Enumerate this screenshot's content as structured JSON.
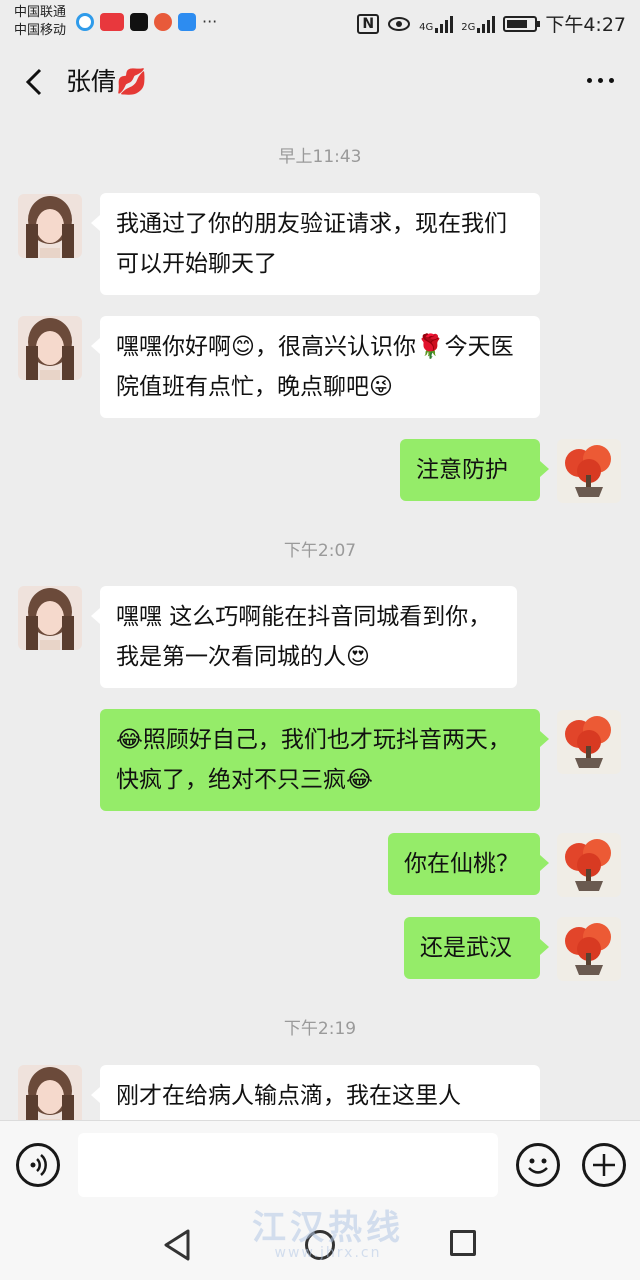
{
  "status_bar": {
    "carrier1": "中国联通",
    "carrier2": "中国移动",
    "apps": [
      "browser-icon",
      "toutiao-icon",
      "douyin-icon",
      "weibo-icon",
      "shield-icon"
    ],
    "app_colors": [
      "#2f9bea",
      "#e8383d",
      "#111111",
      "#e85a3a",
      "#2d8cf0"
    ],
    "more": "···",
    "nfc": "N",
    "net1": "4G",
    "net2": "2G",
    "battery_level": 0.75,
    "time": "下午4:27"
  },
  "header": {
    "back_icon": "chevron-left-icon",
    "title": "张倩💋",
    "more_icon": "more-dots-icon"
  },
  "chat": {
    "timestamps": [
      "早上11:43",
      "下午2:07",
      "下午2:19"
    ],
    "messages": [
      {
        "side": "left",
        "text": "我通过了你的朋友验证请求，现在我们可以开始聊天了"
      },
      {
        "side": "left",
        "text": "嘿嘿你好啊😊，很高兴认识你🌹今天医院值班有点忙，晚点聊吧😜"
      },
      {
        "side": "right",
        "text": "注意防护"
      },
      {
        "side": "left",
        "text": "嘿嘿 这么巧啊能在抖音同城看到你，我是第一次看同城的人😍"
      },
      {
        "side": "right",
        "text": "😂照顾好自己，我们也才玩抖音两天，快疯了，绝对不只三疯😂"
      },
      {
        "side": "right",
        "text": "你在仙桃？"
      },
      {
        "side": "right",
        "text": "还是武汉"
      },
      {
        "side": "left",
        "text": "刚才在给病人输点滴，我在这里人"
      }
    ]
  },
  "input_bar": {
    "voice_icon": "voice-icon",
    "emoji_icon": "emoji-icon",
    "plus_icon": "plus-icon",
    "input_value": ""
  },
  "nav_bar": {
    "back_icon": "nav-back-icon",
    "home_icon": "nav-home-icon",
    "recent_icon": "nav-recent-icon"
  },
  "watermark": {
    "title": "江汉热线",
    "url": "www.jhrx.cn"
  },
  "colors": {
    "background": "#ededed",
    "bubble_self": "#95ec69",
    "bubble_other": "#ffffff",
    "timestamp": "#9a9a9a"
  }
}
